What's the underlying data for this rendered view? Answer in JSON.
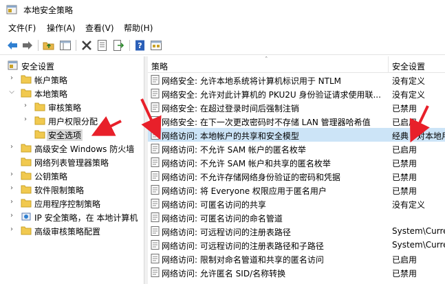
{
  "window": {
    "title": "本地安全策略"
  },
  "menu": [
    "文件(F)",
    "操作(A)",
    "查看(V)",
    "帮助(H)"
  ],
  "toolbar": {
    "buttons": [
      "back-icon",
      "forward-icon",
      "up-folder-icon",
      "show-tree-icon",
      "delete-icon",
      "properties-icon",
      "export-icon",
      "help-icon",
      "view-icon"
    ]
  },
  "tree": {
    "root": "安全设置",
    "items": [
      {
        "label": "帐户策略",
        "level": 1,
        "expanded": false
      },
      {
        "label": "本地策略",
        "level": 1,
        "expanded": true
      },
      {
        "label": "审核策略",
        "level": 2,
        "expanded": false
      },
      {
        "label": "用户权限分配",
        "level": 2,
        "expanded": false
      },
      {
        "label": "安全选项",
        "level": 2,
        "selected": true
      },
      {
        "label": "高级安全 Windows 防火墙",
        "level": 1,
        "expanded": false
      },
      {
        "label": "网络列表管理器策略",
        "level": 1
      },
      {
        "label": "公钥策略",
        "level": 1,
        "expanded": false
      },
      {
        "label": "软件限制策略",
        "level": 1,
        "expanded": false
      },
      {
        "label": "应用程序控制策略",
        "level": 1,
        "expanded": false
      },
      {
        "label": "IP 安全策略，在 本地计算机",
        "level": 1,
        "expanded": false
      },
      {
        "label": "高级审核策略配置",
        "level": 1,
        "expanded": false
      }
    ]
  },
  "list": {
    "columns": [
      "策略",
      "安全设置"
    ],
    "rows": [
      {
        "name": "网络安全: 允许本地系统将计算机标识用于 NTLM",
        "value": "没有定义"
      },
      {
        "name": "网络安全: 允许对此计算机的 PKU2U 身份验证请求使用联...",
        "value": "没有定义"
      },
      {
        "name": "网络安全: 在超过登录时间后强制注销",
        "value": "已禁用"
      },
      {
        "name": "网络安全: 在下一次更改密码时不存储 LAN 管理器哈希值",
        "value": "已启用"
      },
      {
        "name": "网络访问: 本地帐户的共享和安全模型",
        "value": "经典 - 对本地用户",
        "selected": true
      },
      {
        "name": "网络访问: 不允许 SAM 帐户的匿名枚举",
        "value": "已启用"
      },
      {
        "name": "网络访问: 不允许 SAM 帐户和共享的匿名枚举",
        "value": "已禁用"
      },
      {
        "name": "网络访问: 不允许存储网络身份验证的密码和凭据",
        "value": "已禁用"
      },
      {
        "name": "网络访问: 将 Everyone 权限应用于匿名用户",
        "value": "已禁用"
      },
      {
        "name": "网络访问: 可匿名访问的共享",
        "value": "没有定义"
      },
      {
        "name": "网络访问: 可匿名访问的命名管道",
        "value": ""
      },
      {
        "name": "网络访问: 可远程访问的注册表路径",
        "value": "System\\CurrentC"
      },
      {
        "name": "网络访问: 可远程访问的注册表路径和子路径",
        "value": "System\\CurrentC"
      },
      {
        "name": "网络访问: 限制对命名管道和共享的匿名访问",
        "value": "已启用"
      },
      {
        "name": "网络访问: 允许匿名 SID/名称转换",
        "value": "已禁用"
      }
    ]
  },
  "colors": {
    "selection": "#cce4f7",
    "annotation_arrow": "#e8202a",
    "folder": "#f1c94f"
  }
}
